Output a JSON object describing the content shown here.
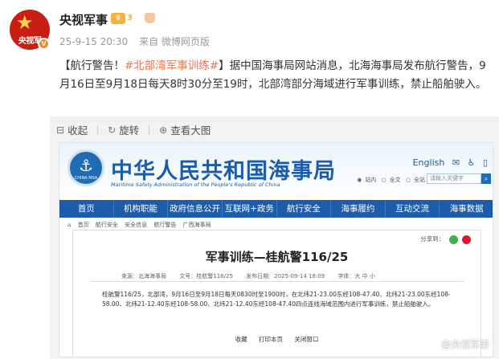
{
  "post": {
    "author": "央视军事",
    "avatar_text": "央视军",
    "verified_badge": "V",
    "level_badge": "♛",
    "level_number": "3",
    "time": "25-9-15 20:30",
    "source": "来自 微博网页版",
    "text_prefix": "【航行警告！",
    "topic": "#北部湾军事训练#",
    "text_body": "】据中国海事局网站消息，北海海事局发布航行警告，9月16日至9月18日每天8时30分至19时，北部湾部分海域进行军事训练，禁止船舶驶入。"
  },
  "image_toolbar": {
    "collect": "收起",
    "rotate": "旋转",
    "view_large": "查看大图"
  },
  "msa": {
    "logo_text": "CHINA MSA",
    "title": "中华人民共和国海事局",
    "subtitle": "Maritime Safety Administration of the People's Republic of China",
    "util_english": "English",
    "search_options": [
      "站内",
      "全文",
      "全站"
    ],
    "search_placeholder": "请输入关键字",
    "nav": [
      "首页",
      "机构职能",
      "政府信息公开",
      "互联网+政务",
      "航行安全",
      "海事履约",
      "互动交流",
      "海事数据"
    ],
    "breadcrumb": [
      "首页",
      "航行安全",
      "安全信息",
      "航行警告",
      "广西海事局"
    ],
    "share_label": "分享到：",
    "article_title": "军事训练—桂航警116/25",
    "info": {
      "source": "来源：北海海事局",
      "doc_no": "文号：桂航警116/25",
      "date": "发布日期：2025-09-14 18:09",
      "font": "字体：大 中 小"
    },
    "body": "桂航警116/25，北部湾，9月16日至9月18日每天0830时至1900时，在北纬21-23.00东经108-47.40、北纬21-23.00东经108-58.00、北纬21-12.40东经108-58.00、北纬21-12.40东经108-47.40四点连线海域范围内进行军事训练，禁止船舶驶入。",
    "footer": [
      "收藏",
      "打印本页",
      "关闭窗口"
    ]
  },
  "watermark": "@央视军事",
  "colors": {
    "weibo_topic": "#eb7350",
    "msa_blue": "#1c5ca8",
    "avatar_red": "#c81e14"
  }
}
